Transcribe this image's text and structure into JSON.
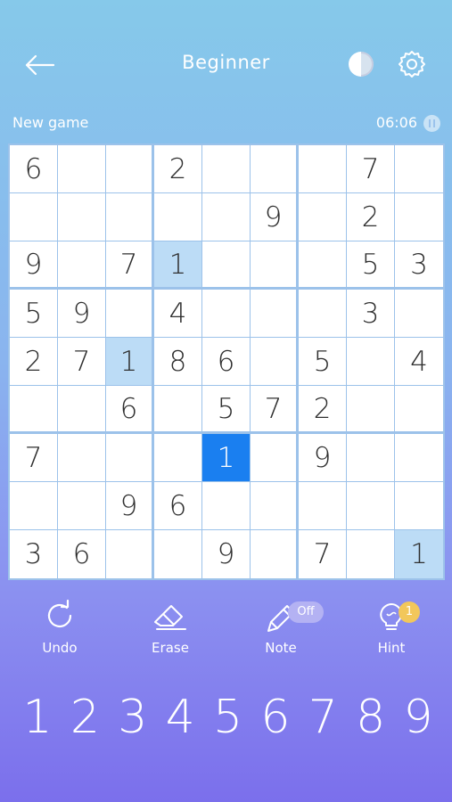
{
  "header": {
    "title": "Beginner",
    "back_icon": "arrow-left-icon",
    "contrast_icon": "half-circle-icon",
    "settings_icon": "gear-icon"
  },
  "subbar": {
    "new_game": "New game",
    "timer": "06:06",
    "pause_icon": "pause-icon"
  },
  "board": {
    "cells": [
      [
        "6",
        "",
        "",
        "2",
        "",
        "",
        "",
        "7",
        ""
      ],
      [
        "",
        "",
        "",
        "",
        "",
        "9",
        "",
        "2",
        ""
      ],
      [
        "9",
        "",
        "7",
        "1",
        "",
        "",
        "",
        "5",
        "3"
      ],
      [
        "5",
        "9",
        "",
        "4",
        "",
        "",
        "",
        "3",
        ""
      ],
      [
        "2",
        "7",
        "1",
        "8",
        "6",
        "",
        "5",
        "",
        "4"
      ],
      [
        "",
        "",
        "6",
        "",
        "5",
        "7",
        "2",
        "",
        ""
      ],
      [
        "7",
        "",
        "",
        "",
        "1",
        "",
        "9",
        "",
        ""
      ],
      [
        "",
        "",
        "9",
        "6",
        "",
        "",
        "",
        "",
        ""
      ],
      [
        "3",
        "6",
        "",
        "",
        "9",
        "",
        "7",
        "",
        "1"
      ]
    ],
    "selected": [
      6,
      4
    ],
    "highlighted": [
      [
        2,
        3
      ],
      [
        4,
        2
      ],
      [
        8,
        8
      ]
    ],
    "colors": {
      "selected": "#1a7ff0",
      "highlight": "#bcdcf6",
      "grid": "#9cc2ea"
    }
  },
  "tools": {
    "undo": {
      "label": "Undo",
      "icon": "undo-icon"
    },
    "erase": {
      "label": "Erase",
      "icon": "eraser-icon"
    },
    "note": {
      "label": "Note",
      "icon": "pencil-icon",
      "badge": "Off"
    },
    "hint": {
      "label": "Hint",
      "icon": "lightbulb-icon",
      "badge": "1"
    }
  },
  "numpad": [
    "1",
    "2",
    "3",
    "4",
    "5",
    "6",
    "7",
    "8",
    "9"
  ]
}
